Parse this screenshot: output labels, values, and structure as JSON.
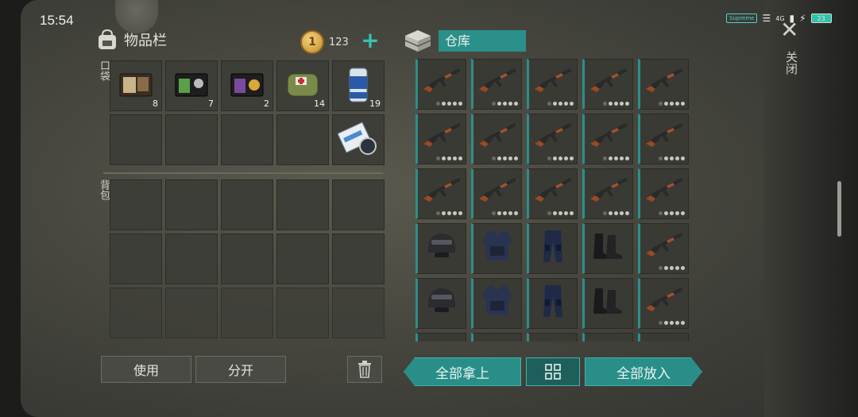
{
  "status_bar": {
    "time": "15:54",
    "brand_chip": "Supreme",
    "network": "4G",
    "battery": "23"
  },
  "inventory": {
    "title": "物品栏",
    "coins": "123",
    "plus_label": "+",
    "pocket_label": "口袋",
    "backpack_label": "背包",
    "pocket_items": [
      {
        "icon": "brown-wallet-icon",
        "count": "8"
      },
      {
        "icon": "black-wallet-icon",
        "count": "7"
      },
      {
        "icon": "badge-wallet-icon",
        "count": "2"
      },
      {
        "icon": "medkit-bag-icon",
        "count": "14"
      },
      {
        "icon": "beer-can-icon",
        "count": "19"
      }
    ],
    "pocket_row2_item": {
      "icon": "map-scroll-icon",
      "count": ""
    }
  },
  "warehouse": {
    "title": "仓库",
    "rows": [
      [
        "ak-rifle",
        "ak-rifle",
        "ak-rifle",
        "ak-rifle",
        "ak-rifle"
      ],
      [
        "ak-rifle",
        "ak-rifle",
        "ak-rifle",
        "ak-rifle",
        "ak-rifle"
      ],
      [
        "ak-rifle",
        "ak-rifle",
        "ak-rifle",
        "ak-rifle",
        "ak-rifle"
      ],
      [
        "swat-helmet",
        "swat-vest",
        "swat-pants",
        "combat-boots",
        "ak-rifle"
      ],
      [
        "swat-helmet",
        "swat-vest",
        "swat-pants",
        "combat-boots",
        "ak-rifle"
      ]
    ]
  },
  "actions": {
    "use_label": "使用",
    "split_label": "分开",
    "take_all_label": "全部拿上",
    "put_all_label": "全部放入"
  },
  "close": {
    "label": "关闭"
  },
  "colors": {
    "accent": "#2a8e88",
    "accent_light": "#3fb4ac"
  }
}
